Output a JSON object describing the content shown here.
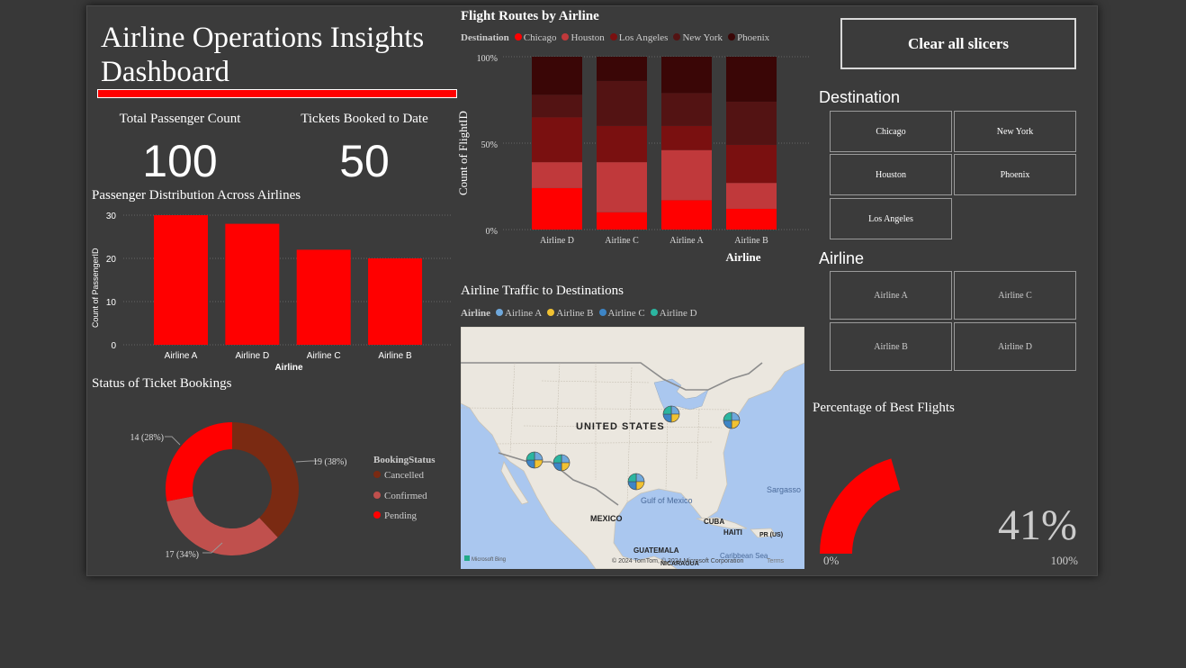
{
  "header": {
    "title": "Airline Operations Insights Dashboard"
  },
  "kpis": [
    {
      "label": "Total Passenger Count",
      "value": "100"
    },
    {
      "label": "Tickets Booked to Date",
      "value": "50"
    }
  ],
  "passenger_chart": {
    "title": "Passenger Distribution Across Airlines",
    "ylabel": "Count of PassengerID",
    "xlabel": "Airline",
    "ticks": [
      "0",
      "10",
      "20",
      "30"
    ]
  },
  "routes_chart": {
    "title": "Flight Routes by Airline",
    "legend_title": "Destination",
    "ylabel": "Count of FlightID",
    "xlabel": "Airline",
    "ticks": [
      "0%",
      "50%",
      "100%"
    ]
  },
  "booking_chart": {
    "title": "Status of Ticket Bookings",
    "legend_title": "BookingStatus",
    "labels": [
      "19 (38%)",
      "17 (34%)",
      "14 (28%)"
    ]
  },
  "map": {
    "title": "Airline Traffic to Destinations",
    "legend_title": "Airline",
    "legend": [
      {
        "name": "Airline A",
        "color": "#6fa8dc"
      },
      {
        "name": "Airline B",
        "color": "#f1c232"
      },
      {
        "name": "Airline C",
        "color": "#3d85c6"
      },
      {
        "name": "Airline D",
        "color": "#2bb5a0"
      }
    ],
    "labels": {
      "us": "UNITED STATES",
      "gulf": "Gulf of Mexico",
      "mexico": "MEXICO",
      "cuba": "CUBA",
      "haiti": "HAITI",
      "pr": "PR (US)",
      "sargasso": "Sargasso",
      "guatemala": "GUATEMALA",
      "nicaragua": "NICARAGUA",
      "caribbean": "Caribbean Sea",
      "bing": "Microsoft Bing",
      "copyright": "© 2024 TomTom, © 2024 Microsoft Corporation",
      "terms": "Terms"
    }
  },
  "slicers": {
    "clear_label": "Clear all slicers",
    "destination_title": "Destination",
    "destinations": [
      "Chicago",
      "New York",
      "Houston",
      "Phoenix",
      "Los Angeles"
    ],
    "airline_title": "Airline",
    "airlines": [
      "Airline A",
      "Airline C",
      "Airline B",
      "Airline D"
    ]
  },
  "gauge": {
    "title": "Percentage of Best Flights",
    "value_label": "41%",
    "min_label": "0%",
    "max_label": "100%",
    "value": 0.41,
    "color": "#ff0000"
  },
  "chart_data": [
    {
      "type": "bar",
      "title": "Passenger Distribution Across Airlines",
      "xlabel": "Airline",
      "ylabel": "Count of PassengerID",
      "categories": [
        "Airline A",
        "Airline D",
        "Airline C",
        "Airline B"
      ],
      "values": [
        30,
        28,
        22,
        20
      ],
      "ylim": [
        0,
        30
      ],
      "color": "#ff0000"
    },
    {
      "type": "bar",
      "stacked": "100%",
      "title": "Flight Routes by Airline",
      "xlabel": "Airline",
      "ylabel": "Count of FlightID",
      "categories": [
        "Airline D",
        "Airline C",
        "Airline A",
        "Airline B"
      ],
      "series": [
        {
          "name": "Chicago",
          "color": "#ff0000",
          "values": [
            24,
            10,
            17,
            12
          ]
        },
        {
          "name": "Houston",
          "color": "#c0393b",
          "values": [
            15,
            29,
            29,
            15
          ]
        },
        {
          "name": "Los Angeles",
          "color": "#7a1010",
          "values": [
            26,
            21,
            14,
            22
          ]
        },
        {
          "name": "New York",
          "color": "#531313",
          "values": [
            13,
            26,
            19,
            25
          ]
        },
        {
          "name": "Phoenix",
          "color": "#3a0606",
          "values": [
            22,
            14,
            21,
            26
          ]
        }
      ]
    },
    {
      "type": "pie",
      "donut": true,
      "title": "Status of Ticket Bookings",
      "legend_title": "BookingStatus",
      "categories": [
        "Cancelled",
        "Confirmed",
        "Pending"
      ],
      "values": [
        19,
        17,
        14
      ],
      "colors": [
        "#7a2a12",
        "#c0504d",
        "#ff0000"
      ]
    }
  ]
}
